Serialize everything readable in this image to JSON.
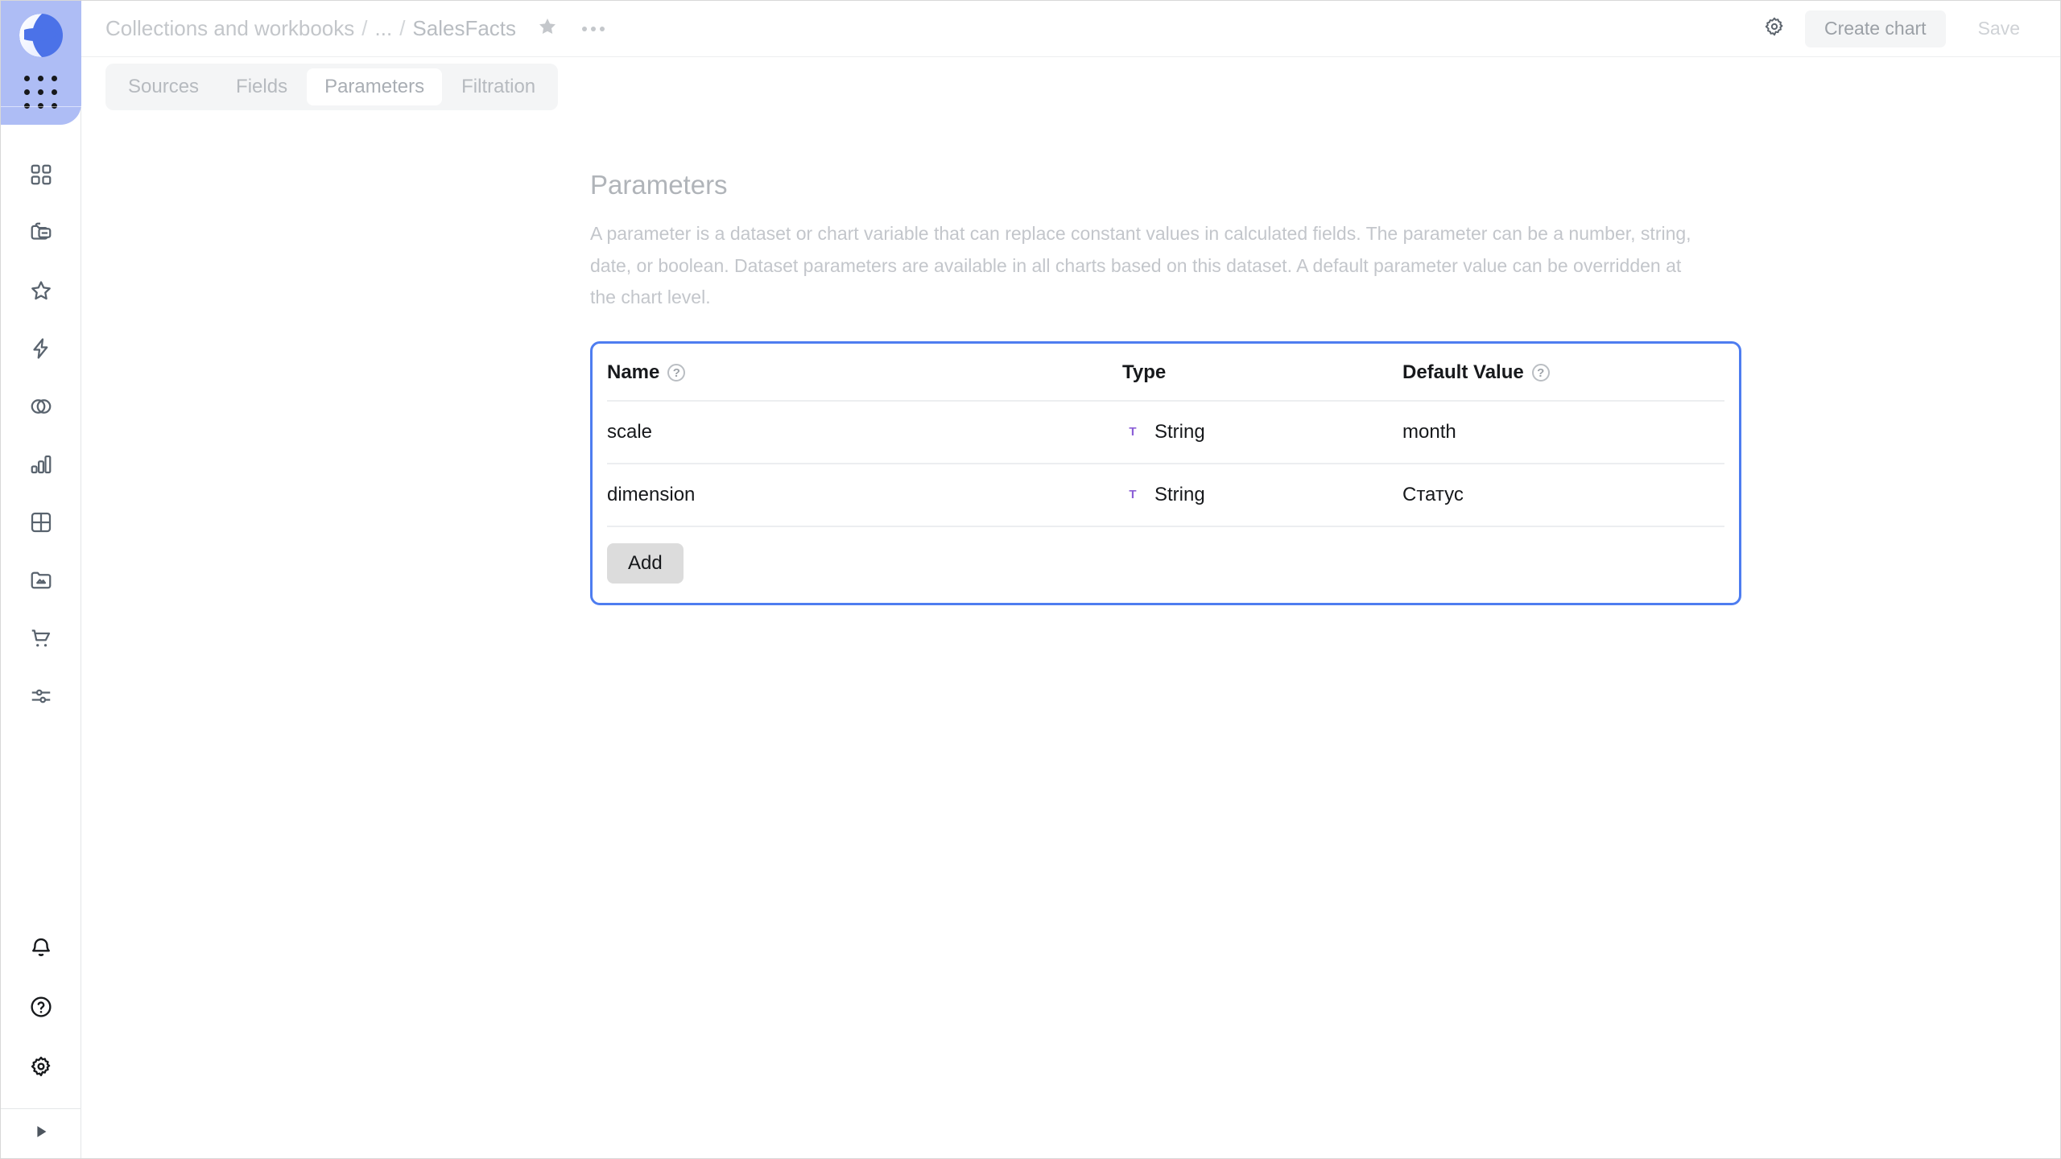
{
  "app": {
    "logo_icon": "datalens-sphere-logo",
    "apps_grid_icon": "apps-grid-icon"
  },
  "sidebar": {
    "nav_items": [
      {
        "icon": "grid-squares-icon",
        "name": "sidebar-item-overview"
      },
      {
        "icon": "collections-folder-icon",
        "name": "sidebar-item-collections"
      },
      {
        "icon": "star-icon",
        "name": "sidebar-item-favorites"
      },
      {
        "icon": "lightning-bolt-icon",
        "name": "sidebar-item-connections"
      },
      {
        "icon": "venn-circles-icon",
        "name": "sidebar-item-datasets"
      },
      {
        "icon": "bar-chart-icon",
        "name": "sidebar-item-charts"
      },
      {
        "icon": "table-grid-icon",
        "name": "sidebar-item-tables"
      },
      {
        "icon": "folder-image-icon",
        "name": "sidebar-item-dashboards"
      },
      {
        "icon": "shopping-cart-icon",
        "name": "sidebar-item-marketplace"
      },
      {
        "icon": "sliders-icon",
        "name": "sidebar-item-settings-nav"
      }
    ],
    "bottom_items": [
      {
        "icon": "bell-icon",
        "name": "sidebar-item-notifications"
      },
      {
        "icon": "question-circle-icon",
        "name": "sidebar-item-help"
      },
      {
        "icon": "gear-icon",
        "name": "sidebar-item-settings"
      }
    ],
    "collapse_icon": "play-triangle-icon"
  },
  "header": {
    "breadcrumb": {
      "root": "Collections and workbooks",
      "ellipsis": "...",
      "current": "SalesFacts",
      "separator": "/"
    },
    "star_icon": "star-filled-icon",
    "more_icon": "more-horizontal-icon",
    "settings_icon": "gear-icon",
    "create_chart_label": "Create chart",
    "save_label": "Save"
  },
  "tabs": [
    {
      "label": "Sources",
      "active": false
    },
    {
      "label": "Fields",
      "active": false
    },
    {
      "label": "Parameters",
      "active": true
    },
    {
      "label": "Filtration",
      "active": false
    }
  ],
  "main": {
    "title": "Parameters",
    "description": "A parameter is a dataset or chart variable that can replace constant values in calculated fields. The parameter can be a number, string, date, or boolean. Dataset parameters are available in all charts based on this dataset. A default parameter value can be overridden at the chart level.",
    "table": {
      "columns": [
        {
          "label": "Name",
          "help": true
        },
        {
          "label": "Type",
          "help": false
        },
        {
          "label": "Default Value",
          "help": true
        }
      ],
      "rows": [
        {
          "name": "scale",
          "type": "String",
          "type_icon": "string-type-icon",
          "default_value": "month"
        },
        {
          "name": "dimension",
          "type": "String",
          "type_icon": "string-type-icon",
          "default_value": "Статус"
        }
      ],
      "add_label": "Add"
    },
    "focus_border_color": "#4e7df0",
    "type_icon_color": "#8b5fd6"
  }
}
